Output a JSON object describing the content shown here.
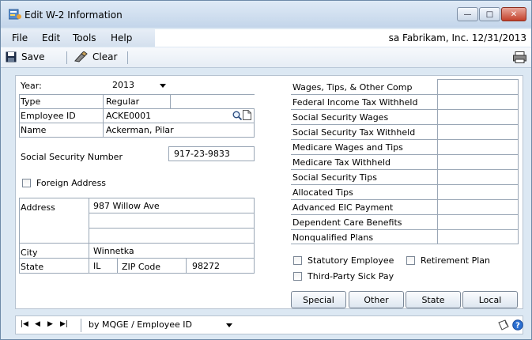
{
  "window": {
    "title": "Edit W-2 Information"
  },
  "window_buttons": {
    "minimize": "—",
    "maximize": "□",
    "close": "✕"
  },
  "menu": {
    "items": [
      "File",
      "Edit",
      "Tools",
      "Help"
    ]
  },
  "company_info": "sa  Fabrikam, Inc.  12/31/2013",
  "toolbar": {
    "save_label": "Save",
    "clear_label": "Clear"
  },
  "left": {
    "year_label": "Year:",
    "year_value": "2013",
    "type_label": "Type",
    "type_value": "Regular",
    "employee_id_label": "Employee ID",
    "employee_id_value": "ACKE0001",
    "name_label": "Name",
    "name_value": "Ackerman, Pilar",
    "ssn_label": "Social Security Number",
    "ssn_value": "917-23-9833",
    "foreign_address_label": "Foreign Address",
    "address_label": "Address",
    "address_line1": "987 Willow Ave",
    "address_line2": "",
    "address_line3": "",
    "city_label": "City",
    "city_value": "Winnetka",
    "state_label": "State",
    "state_value": "IL",
    "zip_label": "ZIP Code",
    "zip_value": "98272"
  },
  "right": {
    "fields": [
      {
        "label": "Wages, Tips, & Other Comp",
        "value": ""
      },
      {
        "label": "Federal Income Tax Withheld",
        "value": ""
      },
      {
        "label": "Social Security Wages",
        "value": ""
      },
      {
        "label": "Social Security Tax Withheld",
        "value": ""
      },
      {
        "label": "Medicare Wages and Tips",
        "value": ""
      },
      {
        "label": "Medicare Tax Withheld",
        "value": ""
      },
      {
        "label": "Social Security Tips",
        "value": ""
      },
      {
        "label": "Allocated Tips",
        "value": ""
      },
      {
        "label": "Advanced EIC Payment",
        "value": ""
      },
      {
        "label": "Dependent Care Benefits",
        "value": ""
      },
      {
        "label": "Nonqualified Plans",
        "value": ""
      }
    ],
    "statutory_employee": "Statutory Employee",
    "retirement_plan": "Retirement Plan",
    "third_party_sick_pay": "Third-Party Sick Pay"
  },
  "buttons": {
    "special": "Special",
    "other": "Other",
    "state": "State",
    "local": "Local"
  },
  "status": {
    "sort_value": "by MQGE / Employee ID",
    "nav_first": "|◀",
    "nav_prev": "◀",
    "nav_next": "▶",
    "nav_last": "▶|"
  },
  "icons": [
    "app-icon",
    "save-icon",
    "clear-icon",
    "print-icon",
    "lookup-icon",
    "note-icon",
    "note-window-icon",
    "help-icon"
  ],
  "colors": {
    "window_bg": "#dce8f3",
    "close": "#c3402a",
    "help": "#2b6fd1"
  }
}
